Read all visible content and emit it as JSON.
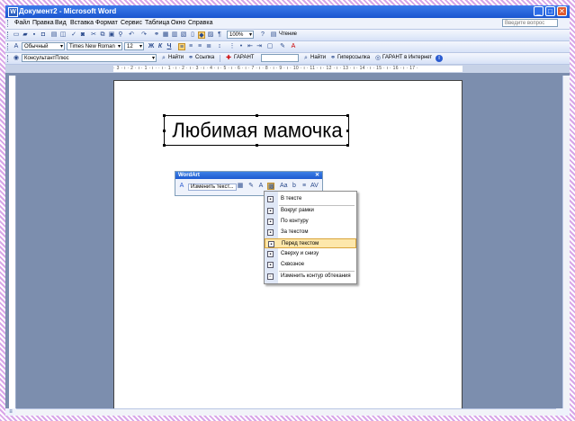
{
  "window": {
    "title": "Документ2 - Microsoft Word",
    "minimize_glyph": "_",
    "maximize_glyph": "□",
    "close_glyph": "✕"
  },
  "menubar": {
    "items": [
      "Файл",
      "Правка",
      "Вид",
      "Вставка",
      "Формат",
      "Сервис",
      "Таблица",
      "Окно",
      "Справка"
    ],
    "help_placeholder": "Введите вопрос"
  },
  "toolbar_standard": {
    "zoom": "100%",
    "reading_label": "Чтение"
  },
  "toolbar_formatting": {
    "style": "Обычный",
    "font": "Times New Roman",
    "size": "12",
    "bold": "Ж",
    "italic": "К",
    "underline": "Ч"
  },
  "toolbar_consultant": {
    "consultant": "КонсультантПлюс",
    "find1": "Найти",
    "link": "Ссылка",
    "garant_menu": "ГАРАНТ",
    "find2": "Найти",
    "hyperlink": "Гиперссылка",
    "garant_internet": "ГАРАНТ в Интернет"
  },
  "ruler": {
    "marks": "· 3 · ı · 2 · ı · 1 · ı ·   · ı · 1 · ı · 2 · ı · 3 · ı · 4 · ı · 5 · ı · 6 · ı · 7 · ı · 8 · ı · 9 · ı · 10 · ı · 11 · ı · 12 · ı · 13 · ı · 14 · ı · 15 · ı · 16 · ı · 17 ·"
  },
  "document": {
    "wordart_text": "Любимая мамочка"
  },
  "wordart_toolbar": {
    "title": "WordArt",
    "edit_text": "Изменить текст...",
    "close": "✕"
  },
  "wrap_menu": {
    "items": [
      {
        "label": "В тексте"
      },
      {
        "label": "Вокруг рамки"
      },
      {
        "label": "По контуру"
      },
      {
        "label": "За текстом"
      },
      {
        "label": "Перед текстом",
        "selected": true
      },
      {
        "label": "Сверху и снизу"
      },
      {
        "label": "Сквозное"
      },
      {
        "label": "Изменить контур обтекания"
      }
    ]
  }
}
